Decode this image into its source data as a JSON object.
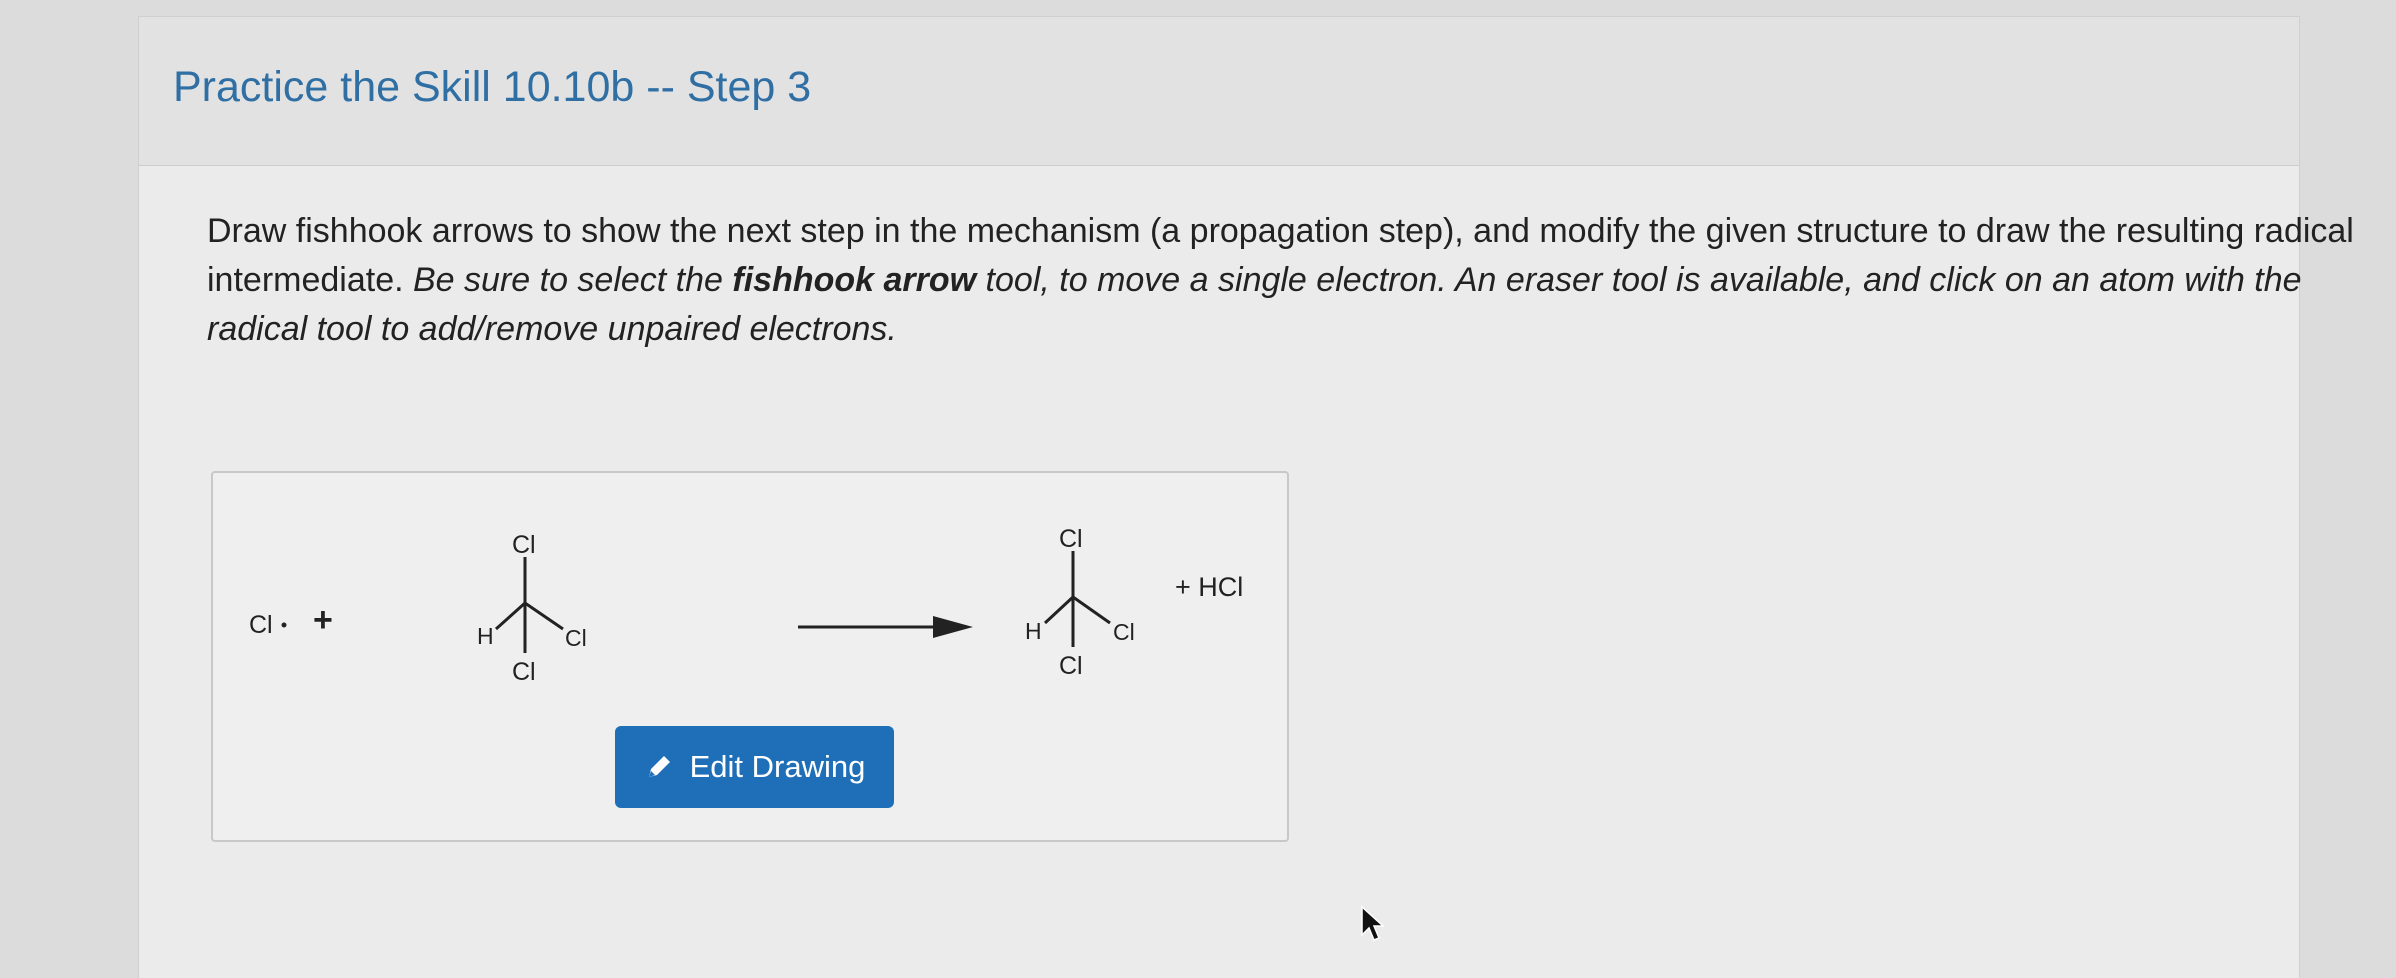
{
  "page": {
    "title": "Practice the Skill 10.10b -- Step 3"
  },
  "instructions": {
    "part1": "Draw fishhook arrows to show the next step in the mechanism (a propagation step), and modify the given structure to draw the resulting radical intermediate. ",
    "part2": "Be sure to select the ",
    "emphasis": "fishhook arrow",
    "part3": " tool, to move a single electron. An eraser tool is available, and click on an atom with the radical tool to add/remove unpaired electrons."
  },
  "scheme": {
    "reactant_radical": "Cl",
    "plus_sign": "+",
    "reactant": {
      "top": "Cl",
      "left": "H",
      "right": "Cl",
      "bottom": "Cl"
    },
    "product": {
      "top": "Cl",
      "left": "H",
      "right": "Cl",
      "bottom": "Cl"
    },
    "byproduct": "+ HCl"
  },
  "edit_button": {
    "label": "Edit Drawing",
    "icon": "pencil-icon",
    "color": "#1f6fb8"
  },
  "colors": {
    "title": "#2f6fa4",
    "header_bg": "#e2e2e2",
    "card_bg": "#ebebeb"
  }
}
